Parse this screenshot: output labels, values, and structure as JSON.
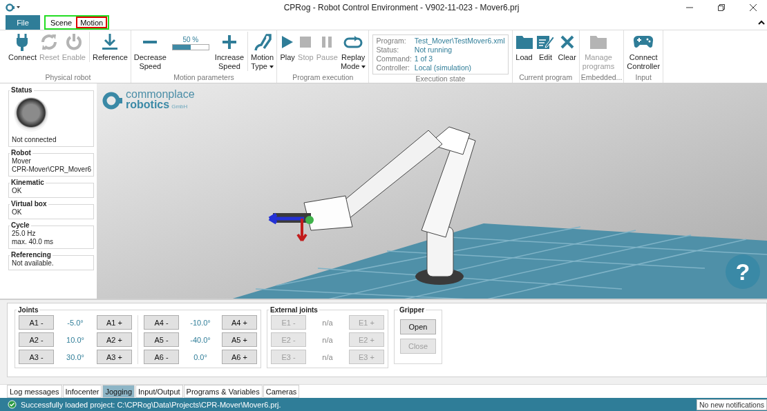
{
  "window": {
    "title": "CPRog - Robot Control Environment - V902-11-023 - Mover6.prj"
  },
  "menu": {
    "file": "File",
    "tab_group": {
      "color": "#22dd22",
      "tabs": [
        {
          "label": "Scene"
        },
        {
          "label": "Motion",
          "color": "#dd0000"
        }
      ]
    }
  },
  "ribbon": [
    {
      "label": "Physical robot",
      "items": [
        {
          "kind": "plug",
          "lines": [
            "Connect"
          ],
          "disabled": false,
          "separator_before": false,
          "dropdown": false
        },
        {
          "kind": "reset",
          "lines": [
            "Reset"
          ],
          "disabled": true,
          "separator_before": false,
          "dropdown": false
        },
        {
          "kind": "power",
          "lines": [
            "Enable"
          ],
          "disabled": true,
          "separator_before": false,
          "dropdown": false
        },
        {
          "kind": "reference",
          "lines": [
            "Reference"
          ],
          "disabled": false,
          "separator_before": true,
          "dropdown": false
        }
      ]
    },
    {
      "label": "Motion parameters",
      "items": [
        {
          "kind": "minus",
          "lines": [
            "Decrease",
            "Speed"
          ],
          "disabled": false,
          "separator_before": false,
          "dropdown": false
        },
        {
          "kind": "slider",
          "reading": "50 %",
          "level": 0.5
        },
        {
          "kind": "plus",
          "lines": [
            "Increase",
            "Speed"
          ],
          "disabled": false,
          "separator_before": false,
          "dropdown": false
        },
        {
          "kind": "motion",
          "lines": [
            "Motion",
            "Type"
          ],
          "disabled": false,
          "separator_before": true,
          "dropdown": true
        }
      ]
    },
    {
      "label": "Program execution",
      "items": [
        {
          "kind": "play",
          "lines": [
            "Play"
          ],
          "disabled": false,
          "separator_before": false,
          "dropdown": false
        },
        {
          "kind": "stop",
          "lines": [
            "Stop"
          ],
          "disabled": true,
          "separator_before": false,
          "dropdown": false
        },
        {
          "kind": "pause",
          "lines": [
            "Pause"
          ],
          "disabled": true,
          "separator_before": false,
          "dropdown": false
        },
        {
          "kind": "replay",
          "lines": [
            "Replay",
            "Mode"
          ],
          "disabled": false,
          "separator_before": false,
          "dropdown": true
        }
      ]
    },
    {
      "label": "Execution state",
      "items": [
        {
          "kind": "info",
          "rows": [
            {
              "label": "Program:",
              "value": "Test_Mover\\TestMover6.xml"
            },
            {
              "label": "Status:",
              "value": "Not running"
            },
            {
              "label": "Command:",
              "value": "1 of 3"
            },
            {
              "label": "Controller:",
              "value": "Local (simulation)"
            }
          ]
        }
      ]
    },
    {
      "label": "Current program",
      "items": [
        {
          "kind": "folder",
          "lines": [
            "Load"
          ],
          "disabled": false,
          "separator_before": false,
          "dropdown": false
        },
        {
          "kind": "edit",
          "lines": [
            "Edit"
          ],
          "disabled": false,
          "separator_before": false,
          "dropdown": false
        },
        {
          "kind": "clear",
          "lines": [
            "Clear"
          ],
          "disabled": false,
          "separator_before": false,
          "dropdown": false
        }
      ]
    },
    {
      "label": "Embedded...",
      "items": [
        {
          "kind": "folder",
          "lines": [
            "Manage",
            "programs"
          ],
          "disabled": true,
          "separator_before": false,
          "dropdown": false
        }
      ]
    },
    {
      "label": "Input",
      "items": [
        {
          "kind": "gamepad",
          "lines": [
            "Connect",
            "Controller"
          ],
          "disabled": false,
          "separator_before": false,
          "dropdown": false
        }
      ]
    }
  ],
  "status_panels": [
    {
      "title": "Status",
      "kind": "led",
      "on": false,
      "lines": [
        "Not connected"
      ]
    },
    {
      "title": "Robot",
      "kind": "text",
      "lines": [
        "Mover",
        "CPR-Mover\\CPR_Mover6"
      ]
    },
    {
      "title": "Kinematic",
      "kind": "text",
      "lines": [
        "OK"
      ]
    },
    {
      "title": "Virtual box",
      "kind": "text",
      "lines": [
        "OK"
      ]
    },
    {
      "title": "Cycle",
      "kind": "text",
      "lines": [
        "25.0 Hz",
        "max. 40.0 ms"
      ]
    },
    {
      "title": "Referencing",
      "kind": "text",
      "lines": [
        "Not available."
      ]
    }
  ],
  "viewport": {
    "logo": {
      "line1": "commonplace",
      "line2": "robotics",
      "suffix": "GmbH"
    },
    "help": "?"
  },
  "jogging": {
    "joints": {
      "title": "Joints",
      "columns": [
        [
          {
            "minus": "A1 -",
            "value": "-5.0°",
            "plus": "A1 +",
            "disabled": false
          },
          {
            "minus": "A2 -",
            "value": "10.0°",
            "plus": "A2 +",
            "disabled": false
          },
          {
            "minus": "A3 -",
            "value": "30.0°",
            "plus": "A3 +",
            "disabled": false
          }
        ],
        [
          {
            "minus": "A4 -",
            "value": "-10.0°",
            "plus": "A4 +",
            "disabled": false
          },
          {
            "minus": "A5 -",
            "value": "-40.0°",
            "plus": "A5 +",
            "disabled": false
          },
          {
            "minus": "A6 -",
            "value": "0.0°",
            "plus": "A6 +",
            "disabled": false
          }
        ]
      ]
    },
    "external": {
      "title": "External joints",
      "rows": [
        {
          "minus": "E1 -",
          "value": "n/a",
          "plus": "E1 +",
          "disabled": true
        },
        {
          "minus": "E2 -",
          "value": "n/a",
          "plus": "E2 +",
          "disabled": true
        },
        {
          "minus": "E3 -",
          "value": "n/a",
          "plus": "E3 +",
          "disabled": true
        }
      ]
    },
    "gripper": {
      "title": "Gripper",
      "buttons": [
        {
          "label": "Open",
          "disabled": false
        },
        {
          "label": "Close",
          "disabled": true
        }
      ]
    }
  },
  "bottom_tabs": [
    {
      "label": "Log messages",
      "selected": false
    },
    {
      "label": "Infocenter",
      "selected": false
    },
    {
      "label": "Jogging",
      "selected": true
    },
    {
      "label": "Input/Output",
      "selected": false
    },
    {
      "label": "Programs & Variables",
      "selected": false
    },
    {
      "label": "Cameras",
      "selected": false
    }
  ],
  "status_bar": {
    "message": "Successfully loaded project: C:\\CPRog\\Data\\Projects\\CPR-Mover\\Mover6.prj.",
    "notifications": "No new notifications"
  }
}
